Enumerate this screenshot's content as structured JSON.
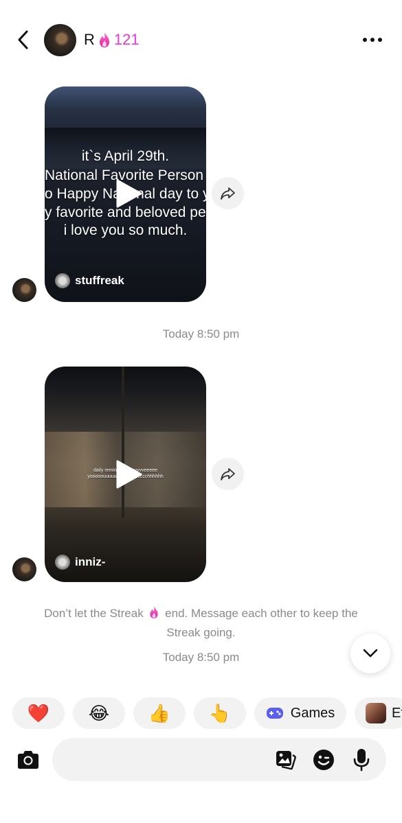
{
  "header": {
    "name": "R",
    "streak_count": "121",
    "back_icon": "chevron-left-icon",
    "more_icon": "more-horizontal-icon"
  },
  "messages": [
    {
      "type": "shared-video",
      "overlay_lines": [
        "it`s April 29th.",
        "National Favorite Person Day",
        "o Happy National day to you",
        "y favorite and beloved perso",
        "i love you so much."
      ],
      "username": "stuffreak"
    },
    {
      "type": "shared-video",
      "overlay_lines": [
        "daily reminder:            oooyyvveeeee",
        "yooooouuuuuu s            uuuuucccchhhhhh"
      ],
      "username": "inniz-"
    }
  ],
  "timestamps": {
    "first": "Today 8:50 pm",
    "second": "Today 8:50 pm"
  },
  "streak_notice": {
    "before_flame": "Don’t let the Streak",
    "after_flame": "end. Message each other to keep the Streak going."
  },
  "quick_replies": {
    "emoji_1": "❤️",
    "emoji_2": "😂",
    "emoji_3": "👍",
    "emoji_4": "👆",
    "games_label": "Games",
    "effects_label": "Ef"
  },
  "composer": {
    "placeholder": "",
    "icons": [
      "camera-icon",
      "gallery-icon",
      "sticker-icon",
      "microphone-icon"
    ]
  },
  "colors": {
    "streak_pink": "#e93ad7",
    "chip_bg": "#f2f2f3",
    "timestamp_gray": "#8a8a8a"
  }
}
